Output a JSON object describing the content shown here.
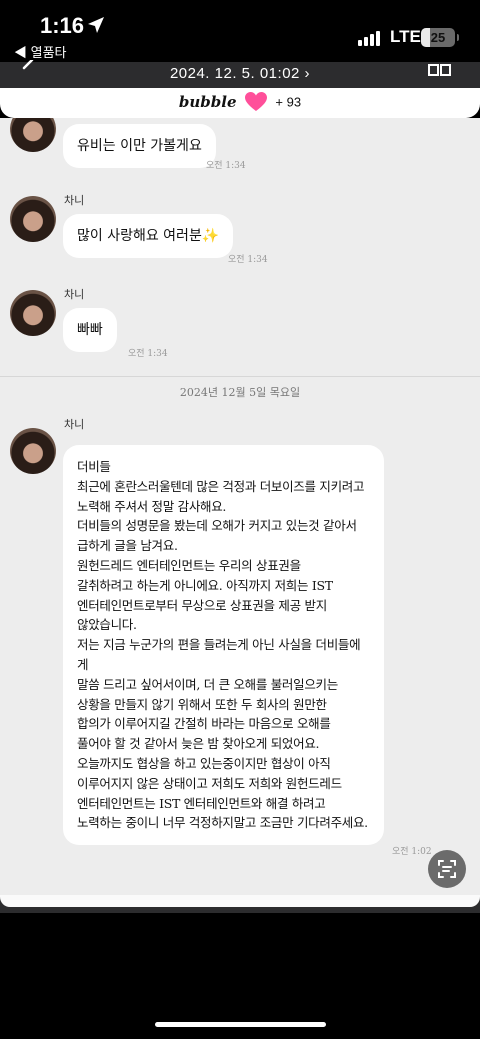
{
  "status_bar": {
    "time": "1:16",
    "back_app": "◀ 열품타",
    "network": "LTE",
    "battery": "25",
    "battery_level": 0.25
  },
  "header": {
    "date": "2024. 12. 5. 01:02 ›"
  },
  "banner": {
    "logo": "bubble",
    "count": "+ 93"
  },
  "messages": [
    {
      "sender": "",
      "text": "유비는 이만 가볼게요",
      "time": "오전 1:34"
    },
    {
      "sender": "차니",
      "text": "많이 사랑해요 여러분✨",
      "time": "오전 1:34"
    },
    {
      "sender": "차니",
      "text": "빠빠",
      "time": "오전 1:34"
    },
    {
      "sender": "차니",
      "text": "더비들\n최근에 혼란스러울텐데 많은 걱정과 더보이즈를 지키려고\n노력해 주셔서 정말 감사해요.\n더비들의 성명문을 봤는데 오해가 커지고 있는것 같아서\n급하게 글을 남겨요.\n원헌드레드 엔터테인먼트는 우리의 상표권을\n갈취하려고 하는게 아니에요. 아직까지 저희는 IST\n엔터테인먼트로부터 무상으로 상표권을 제공 받지\n않았습니다.\n저는 지금 누군가의 편을 들려는게 아닌 사실을 더비들에게\n말씀 드리고 싶어서이며, 더 큰 오해를 불러일으키는\n상황을 만들지 않기 위해서 또한 두 회사의 원만한\n합의가 이루어지길 간절히 바라는 마음으로 오해를\n풀어야 할 것 같아서 늦은 밤 찾아오게 되었어요.\n오늘까지도 협상을 하고 있는중이지만 협상이 아직\n이루어지지 않은 상태이고 저희도 저희와 원헌드레드\n엔터테인먼트는 IST 엔터테인먼트와 해결 하려고\n노력하는 중이니 너무 걱정하지말고 조금만 기다려주세요.",
      "time": "오전 1:02"
    }
  ],
  "date_separator": "2024년 12월 5일 목요일",
  "icons": {
    "location": "location-arrow-icon",
    "back": "chevron-left-icon",
    "gallery": "grid-icon",
    "scan": "text-scan-icon",
    "heart": "heart-icon"
  },
  "colors": {
    "chat_bg": "#ededed",
    "header_bg": "#2c2c2e",
    "heart": "#ff4f9a"
  }
}
